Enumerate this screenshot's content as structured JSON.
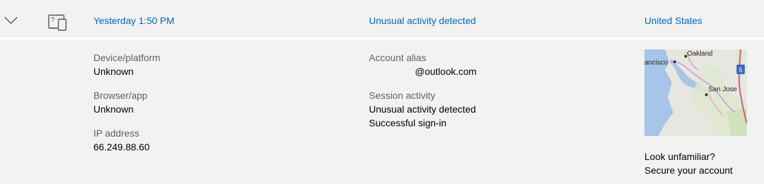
{
  "header": {
    "time": "Yesterday 1:50 PM",
    "activity": "Unusual activity detected",
    "location": "United States"
  },
  "details": {
    "device_label": "Device/platform",
    "device_value": "Unknown",
    "browser_label": "Browser/app",
    "browser_value": "Unknown",
    "ip_label": "IP address",
    "ip_value": "66.249.88.60",
    "alias_label": "Account alias",
    "alias_value": "@outlook.com",
    "session_label": "Session activity",
    "session_items": [
      "Unusual activity detected",
      "Successful sign-in"
    ]
  },
  "map": {
    "places": [
      "Oakland",
      "ancisco",
      "San Jose"
    ],
    "highway": "5"
  },
  "footer": {
    "question": "Look unfamiliar?",
    "secure_link": "Secure your account"
  }
}
